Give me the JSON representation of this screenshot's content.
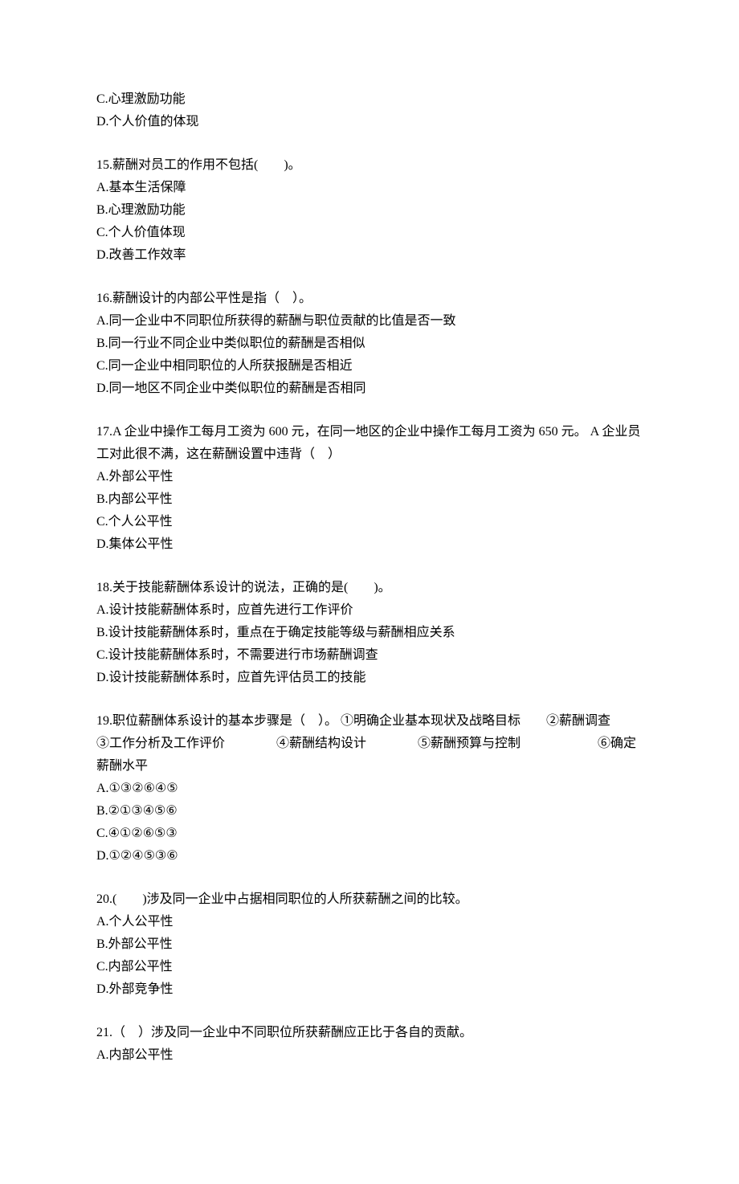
{
  "orphan": {
    "c": "C.心理激励功能",
    "d": "D.个人价值的体现"
  },
  "q15": {
    "stem": "15.薪酬对员工的作用不包括(　　)。",
    "a": "A.基本生活保障",
    "b": "B.心理激励功能",
    "c": "C.个人价值体现",
    "d": "D.改善工作效率"
  },
  "q16": {
    "stem": "16.薪酬设计的内部公平性是指（　）。",
    "a": "A.同一企业中不同职位所获得的薪酬与职位贡献的比值是否一致",
    "b": "B.同一行业不同企业中类似职位的薪酬是否相似",
    "c": "C.同一企业中相同职位的人所获报酬是否相近",
    "d": "D.同一地区不同企业中类似职位的薪酬是否相同"
  },
  "q17": {
    "stem": "17.A 企业中操作工每月工资为 600 元，在同一地区的企业中操作工每月工资为 650 元。 A 企业员工对此很不满，这在薪酬设置中违背（　）",
    "a": "A.外部公平性",
    "b": "B.内部公平性",
    "c": "C.个人公平性",
    "d": "D.集体公平性"
  },
  "q18": {
    "stem": "18.关于技能薪酬体系设计的说法，正确的是(　　)。",
    "a": "A.设计技能薪酬体系时，应首先进行工作评价",
    "b": "B.设计技能薪酬体系时，重点在于确定技能等级与薪酬相应关系",
    "c": "C.设计技能薪酬体系时，不需要进行市场薪酬调查",
    "d": "D.设计技能薪酬体系时，应首先评估员工的技能"
  },
  "q19": {
    "stem": "19.职位薪酬体系设计的基本步骤是（　）。 ①明确企业基本现状及战略目标　　②薪酬调查　　③工作分析及工作评价　　　　④薪酬结构设计　　　　⑤薪酬预算与控制　　　　　　⑥确定薪酬水平",
    "a": "A.①③②⑥④⑤",
    "b": "B.②①③④⑤⑥",
    "c": "C.④①②⑥⑤③",
    "d": "D.①②④⑤③⑥"
  },
  "q20": {
    "stem": "20.(　　)涉及同一企业中占据相同职位的人所获薪酬之间的比较。",
    "a": "A.个人公平性",
    "b": "B.外部公平性",
    "c": "C.内部公平性",
    "d": "D.外部竞争性"
  },
  "q21": {
    "stem": "21.（　）涉及同一企业中不同职位所获薪酬应正比于各自的贡献。",
    "a": "A.内部公平性"
  }
}
